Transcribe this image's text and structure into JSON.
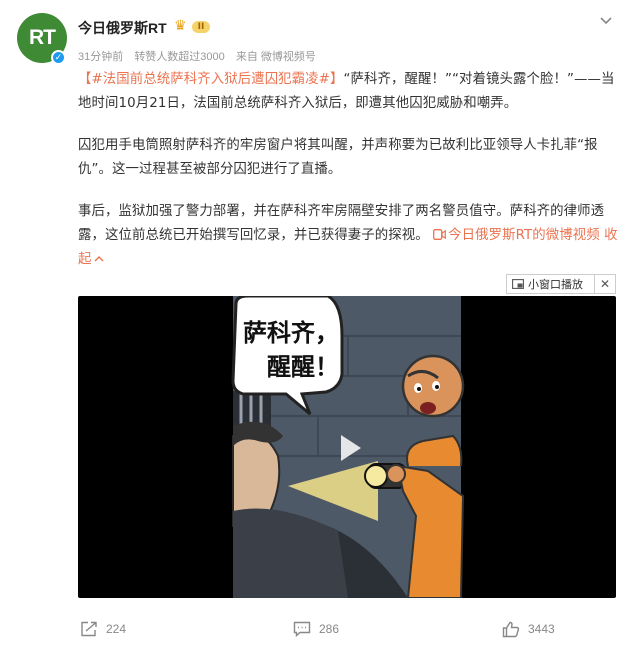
{
  "author": {
    "avatar_text": "RT",
    "name": "今日俄罗斯RT",
    "level": "II"
  },
  "meta": {
    "time": "31分钟前",
    "reposts_note": "转赞人数超过3000",
    "source": "来自 微博视频号"
  },
  "post": {
    "hashtag": "【#法国前总统萨科齐入狱后遭囚犯霸凌#】",
    "p1_rest": "“萨科齐，醒醒！”“对着镜头露个脸！”——当地时间10月21日，法国前总统萨科齐入狱后，即遭其他囚犯威胁和嘲弄。",
    "p2": "囚犯用手电筒照射萨科齐的牢房窗户将其叫醒，并声称要为已故利比亚领导人卡扎菲“报仇”。这一过程甚至被部分囚犯进行了直播。",
    "p3": "事后，监狱加强了警力部署，并在萨科齐牢房隔壁安排了两名警员值守。萨科齐的律师透露，这位前总统已开始撰写回忆录，并已获得妻子的探视。",
    "video_link": "今日俄罗斯RT的微博视频",
    "collapse": "收起"
  },
  "pip": {
    "label": "小窗口播放",
    "close": "✕"
  },
  "video": {
    "speech_line1": "萨科齐，",
    "speech_line2": "醒醒！"
  },
  "footer": {
    "reposts": "224",
    "comments": "286",
    "likes": "3443"
  },
  "colors": {
    "link": "#eb7350",
    "avatar_bg": "#3f8a34",
    "verified": "#1d9bf0"
  }
}
